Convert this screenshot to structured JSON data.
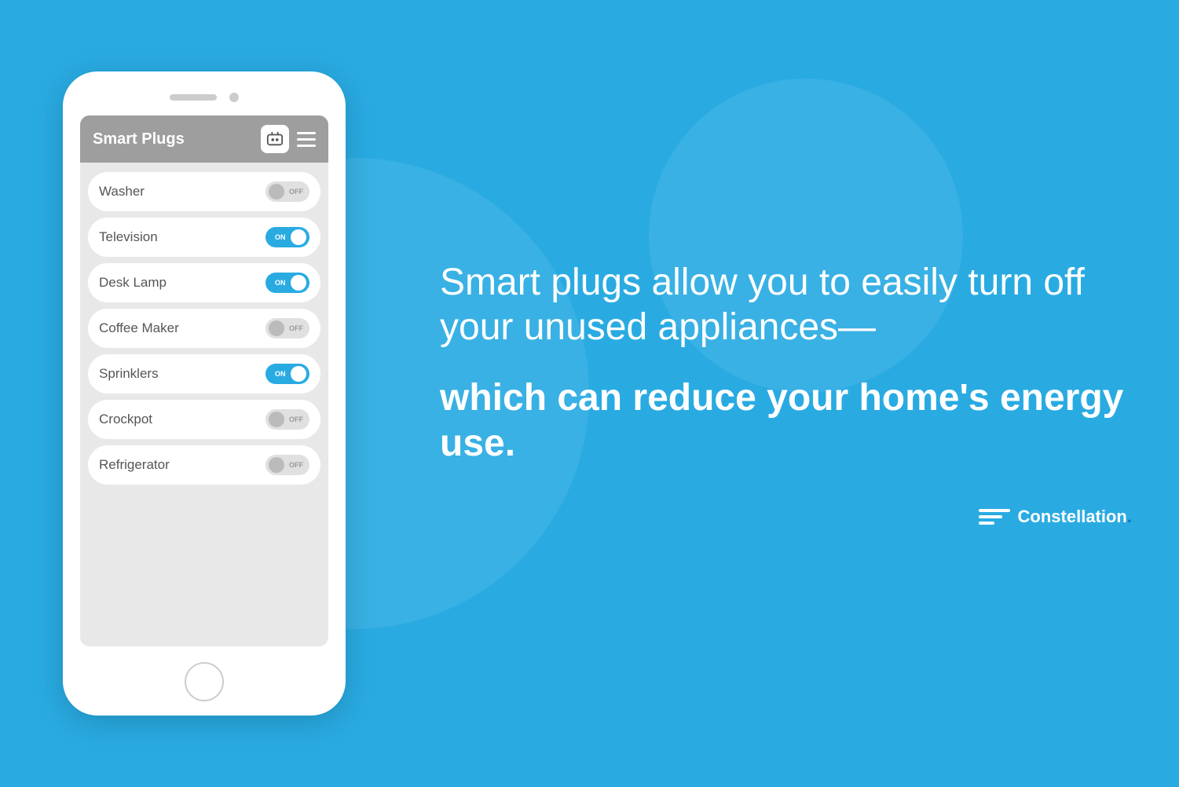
{
  "background_color": "#29abe2",
  "phone": {
    "app_title": "Smart Plugs",
    "devices": [
      {
        "name": "Washer",
        "state": "off"
      },
      {
        "name": "Television",
        "state": "on"
      },
      {
        "name": "Desk Lamp",
        "state": "on"
      },
      {
        "name": "Coffee Maker",
        "state": "off"
      },
      {
        "name": "Sprinklers",
        "state": "on"
      },
      {
        "name": "Crockpot",
        "state": "off"
      },
      {
        "name": "Refrigerator",
        "state": "off"
      }
    ]
  },
  "main_text_normal": "Smart plugs allow you to easily turn off your unused appliances—",
  "main_text_bold": "which can reduce your home's energy use.",
  "logo": {
    "brand": "Constellation",
    "dot": "."
  },
  "toggle_on_label": "ON",
  "toggle_off_label": "OFF"
}
